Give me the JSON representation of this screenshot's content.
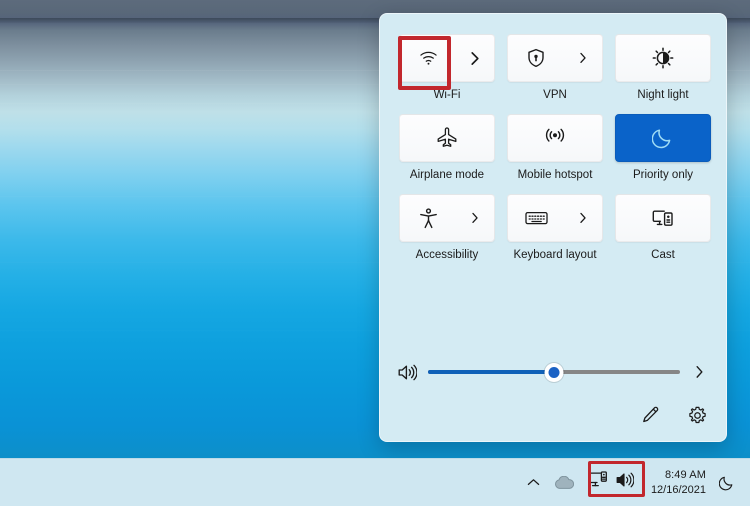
{
  "desktop": {
    "wallpaper_name": "windows-11-lake-wallpaper",
    "colors": {
      "sky": "#5d6b7c",
      "water_light": "#bfe0e8",
      "water_deep": "#0a92d6"
    }
  },
  "quick_settings": {
    "panel_name": "Quick Settings",
    "accent_color": "#0a63c9",
    "panel_background": "#d4ebf3",
    "tiles": [
      {
        "label": "Wi-Fi",
        "icon": "wifi-icon",
        "chevron": true,
        "active": false,
        "highlighted": true
      },
      {
        "label": "VPN",
        "icon": "shield-vpn-icon",
        "chevron": true,
        "active": false,
        "highlighted": false
      },
      {
        "label": "Night light",
        "icon": "brightness-sun-icon",
        "chevron": false,
        "active": false,
        "highlighted": false
      },
      {
        "label": "Airplane mode",
        "icon": "airplane-icon",
        "chevron": false,
        "active": false,
        "highlighted": false
      },
      {
        "label": "Mobile hotspot",
        "icon": "hotspot-antenna-icon",
        "chevron": false,
        "active": false,
        "highlighted": false
      },
      {
        "label": "Priority only",
        "icon": "moon-icon",
        "chevron": false,
        "active": true,
        "highlighted": false
      },
      {
        "label": "Accessibility",
        "icon": "accessibility-icon",
        "chevron": true,
        "active": false,
        "highlighted": false
      },
      {
        "label": "Keyboard layout",
        "icon": "keyboard-icon",
        "chevron": true,
        "active": false,
        "highlighted": false
      },
      {
        "label": "Cast",
        "icon": "cast-icon",
        "chevron": false,
        "active": false,
        "highlighted": false
      }
    ],
    "volume": {
      "icon": "speaker-volume-icon",
      "value": 50,
      "min": 0,
      "max": 100,
      "chevron_icon": "chevron-right-icon",
      "fill_color": "#0f61b8",
      "track_color": "#868686"
    },
    "footer": {
      "edit_icon": "pencil-edit-icon",
      "settings_icon": "gear-settings-icon"
    }
  },
  "taskbar": {
    "background": "#cfe7f1",
    "show_hidden_icons": {
      "icon": "chevron-up-icon"
    },
    "cloud_icon": {
      "icon": "cloud-icon"
    },
    "tray_group": {
      "network_icon": "network-monitor-icon",
      "volume_icon": "speaker-volume-icon",
      "highlighted": true
    },
    "clock": {
      "time": "8:49 AM",
      "date": "12/16/2021"
    },
    "notifications_icon": {
      "icon": "moon-dnd-icon"
    }
  },
  "annotations": {
    "highlight_color": "#c2272d",
    "boxes": [
      {
        "target": "wifi-tile-icon"
      },
      {
        "target": "taskbar-tray-group"
      }
    ]
  }
}
